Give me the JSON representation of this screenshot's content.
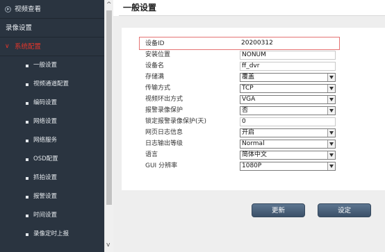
{
  "sidebar": {
    "items": [
      {
        "label": "视频查看",
        "icon": "play-circle-icon"
      },
      {
        "label": "录像设置"
      },
      {
        "label": "系统配置",
        "active": true
      }
    ],
    "sub_items": [
      "一般设置",
      "视频通道配置",
      "编码设置",
      "网络设置",
      "网络服务",
      "OSD配置",
      "抓拍设置",
      "报警设置",
      "时间设置",
      "录像定时上报"
    ]
  },
  "page": {
    "title": "一般设置"
  },
  "form": {
    "rows": [
      {
        "label": "设备ID",
        "value": "20200312",
        "type": "text"
      },
      {
        "label": "安装位置",
        "value": "NONUM",
        "type": "text"
      },
      {
        "label": "设备名",
        "value": "ff_dvr",
        "type": "text"
      },
      {
        "label": "存储满",
        "value": "覆盖",
        "type": "select"
      },
      {
        "label": "传输方式",
        "value": "TCP",
        "type": "select"
      },
      {
        "label": "视频环出方式",
        "value": "VGA",
        "type": "select"
      },
      {
        "label": "报警录像保护",
        "value": "否",
        "type": "select"
      },
      {
        "label": "锁定报警录像保护(天)",
        "value": "0",
        "type": "text"
      },
      {
        "label": "网页日志信息",
        "value": "开启",
        "type": "select"
      },
      {
        "label": "日志输出等级",
        "value": "Normal",
        "type": "select"
      },
      {
        "label": "语言",
        "value": "简体中文",
        "type": "select"
      },
      {
        "label": "GUI 分辨率",
        "value": "1080P",
        "type": "select"
      }
    ]
  },
  "buttons": {
    "update": "更新",
    "set": "设定"
  },
  "colors": {
    "sidebar_bg": "#2a3440",
    "active_nav": "#e2362b",
    "button": "#4a6078",
    "highlight_border": "#e57373"
  }
}
